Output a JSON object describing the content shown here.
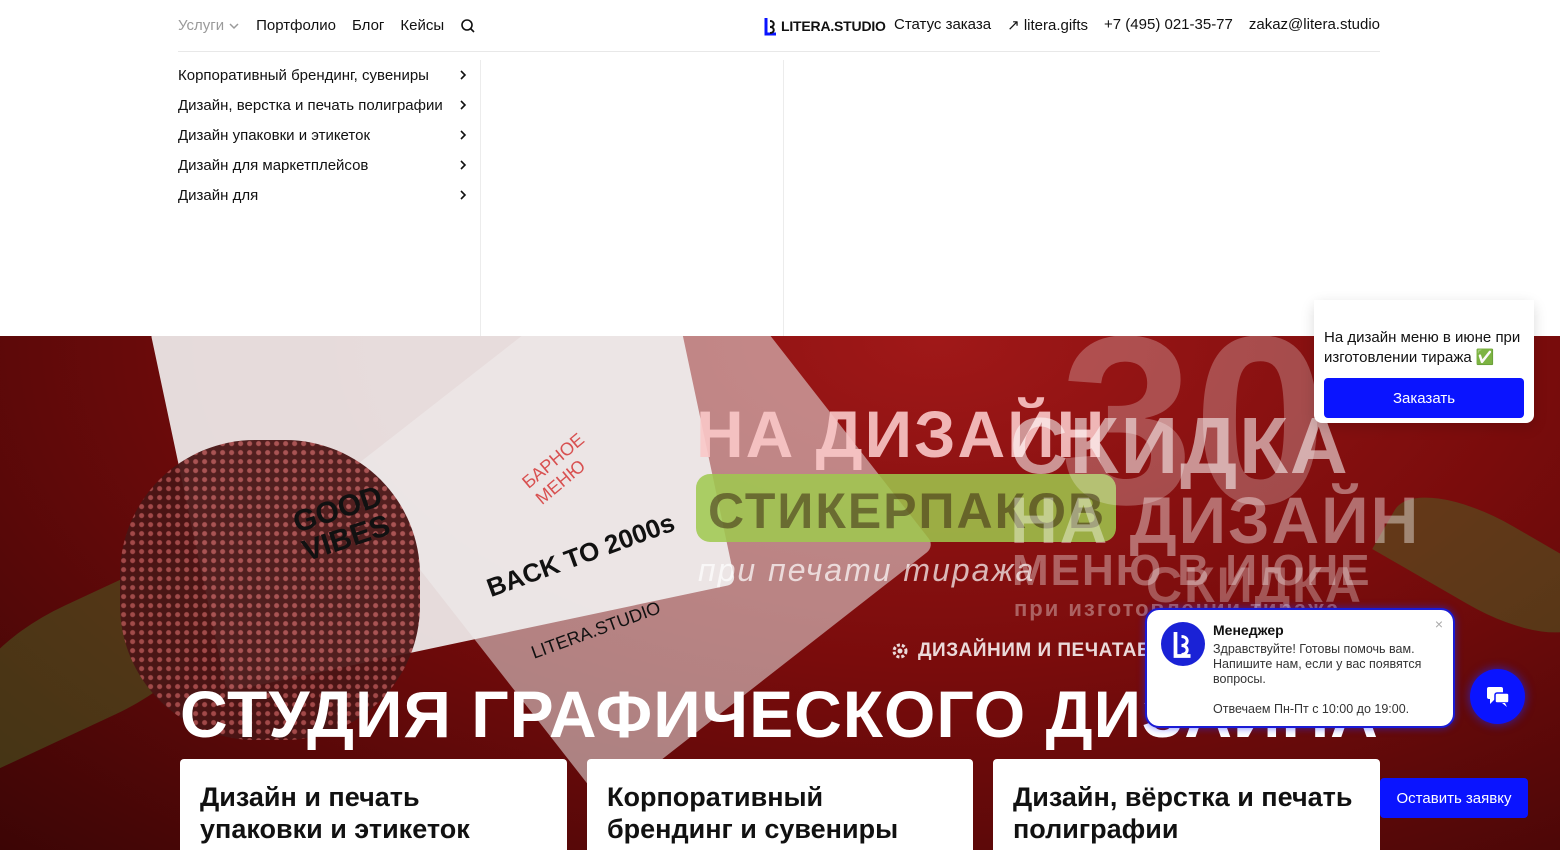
{
  "header": {
    "services_label": "Услуги",
    "nav": [
      "Портфолио",
      "Блог",
      "Кейсы"
    ],
    "logo_text": "LITERA.STUDIO",
    "right_links": [
      "Статус заказа",
      "litera.gifts",
      "+7 (495) 021-35-77",
      "zakaz@litera.studio"
    ]
  },
  "services_menu": {
    "items": [
      "Корпоративный брендинг, сувениры",
      "Дизайн, верстка и печать полиграфии",
      "Дизайн упаковки и этикеток",
      "Дизайн для маркетплейсов",
      "Дизайн для"
    ]
  },
  "hero": {
    "bg_texts": [
      "НА ДИЗАЙН",
      "СТИКЕРПАКОВ",
      "при печати тиража",
      "СКИДКА",
      "НА ДИЗАЙН",
      "МЕНЮ В ИЮНЕ",
      "СКИДКА",
      "при изготовлении тиража",
      "30",
      "БАРНОЕ МЕНЮ",
      "GOOD VIBES",
      "BACK TO 2000s",
      "LITERA.STUDIO"
    ],
    "subtitle": "ДИЗАЙНИМ И ПЕЧАТАЕМ Н",
    "title": "СТУДИЯ ГРАФИЧЕСКОГО ДИЗАЙНА"
  },
  "promo": {
    "text": "На дизайн меню в июне при изготовлении тиража ✅",
    "button": "Заказать"
  },
  "chat": {
    "name": "Менеджер",
    "message": "Здравствуйте! Готовы помочь вам. Напишите нам, если у вас появятся вопросы.",
    "hours": "Отвечаем Пн-Пт с 10:00 до 19:00.",
    "close": "×"
  },
  "lead_button": "Оставить заявку",
  "cards": [
    "Дизайн и печать упаковки и этикеток",
    "Корпоративный брендинг и сувениры",
    "Дизайн, вёрстка и печать полиграфии"
  ],
  "colors": {
    "accent": "#0a14ff",
    "hero_red": "#8a1010"
  }
}
